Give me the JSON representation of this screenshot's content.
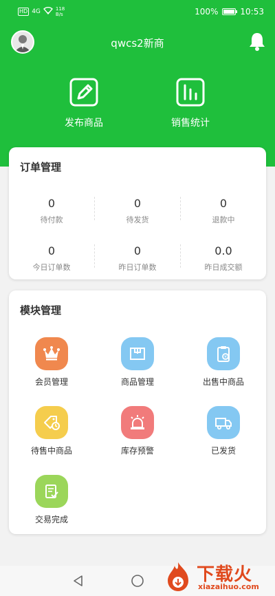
{
  "statusbar": {
    "network_badge": "HD",
    "signal": "4G",
    "speed_value": "118",
    "speed_unit": "B/s",
    "battery": "100%",
    "time": "10:53"
  },
  "header": {
    "title": "qwcs2新商",
    "actions": [
      {
        "label": "发布商品",
        "icon": "edit-icon"
      },
      {
        "label": "销售统计",
        "icon": "stats-icon"
      }
    ],
    "bg_color": "#1fbf3c"
  },
  "orders": {
    "title": "订单管理",
    "stats": [
      {
        "value": "0",
        "label": "待付款"
      },
      {
        "value": "0",
        "label": "待发货"
      },
      {
        "value": "0",
        "label": "退款中"
      },
      {
        "value": "0",
        "label": "今日订单数"
      },
      {
        "value": "0",
        "label": "昨日订单数"
      },
      {
        "value": "0.0",
        "label": "昨日成交额"
      }
    ]
  },
  "modules": {
    "title": "模块管理",
    "items": [
      {
        "label": "会员管理",
        "icon": "crown-icon",
        "color": "#f0884e"
      },
      {
        "label": "商品管理",
        "icon": "box-icon",
        "color": "#84c8f2"
      },
      {
        "label": "出售中商品",
        "icon": "clipboard-icon",
        "color": "#84c8f2"
      },
      {
        "label": "待售中商品",
        "icon": "tag-clock-icon",
        "color": "#f5cd4d"
      },
      {
        "label": "库存预警",
        "icon": "alarm-icon",
        "color": "#f17b7b"
      },
      {
        "label": "已发货",
        "icon": "truck-icon",
        "color": "#84c8f2"
      },
      {
        "label": "交易完成",
        "icon": "document-check-icon",
        "color": "#9bd65a"
      }
    ]
  },
  "navbar": {
    "buttons": [
      "back-icon",
      "home-icon"
    ]
  },
  "watermark": {
    "text": "下载火",
    "url": "xiazaihuo.com"
  }
}
